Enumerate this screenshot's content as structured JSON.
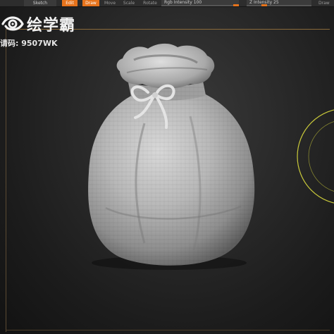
{
  "toolbar": {
    "sketch_label": "Sketch",
    "edit_label": "Edit",
    "draw_label": "Draw",
    "move_label": "Move",
    "scale_label": "Scale",
    "rotate_label": "Rotate",
    "rgb_intensity_label": "Rgb Intensity 100",
    "rgb_intensity_value": 100,
    "z_intensity_label": "Z Intensity 25",
    "z_intensity_value": 25,
    "draw_mode_label": "Draw",
    "active_color": "#e6731c"
  },
  "watermark": {
    "brand": "绘学霸",
    "code_text": "请码: 9507WK"
  },
  "viewport": {
    "model_name_icon": "sack-model",
    "gizmo_color": "#c9c93a"
  }
}
